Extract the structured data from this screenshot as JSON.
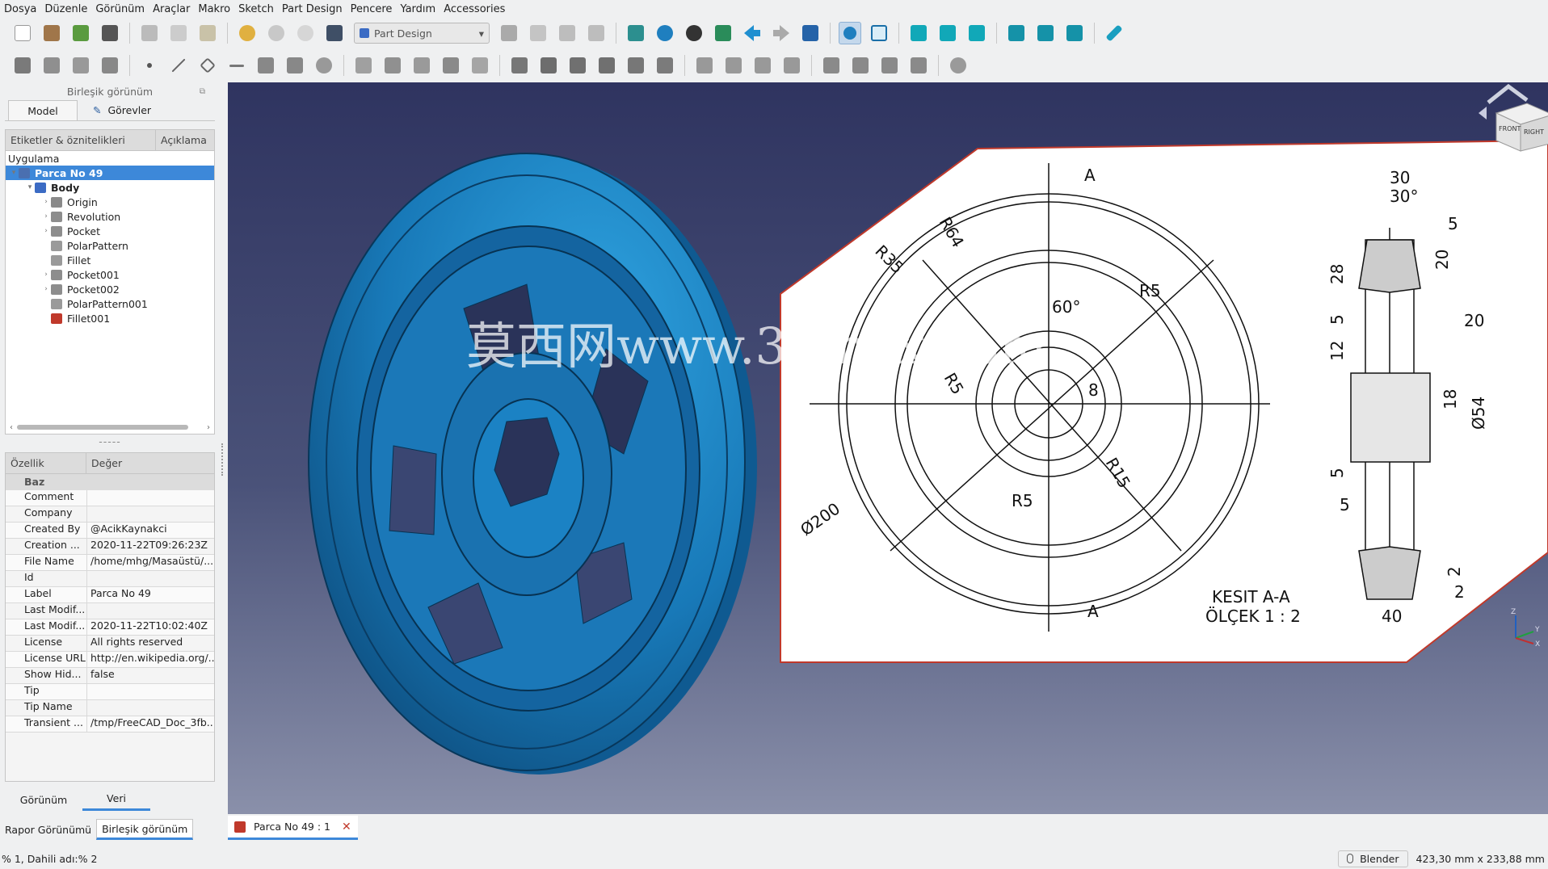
{
  "menubar": {
    "items": [
      "Dosya",
      "Düzenle",
      "Görünüm",
      "Araçlar",
      "Makro",
      "Sketch",
      "Part Design",
      "Pencere",
      "Yardım",
      "Accessories"
    ]
  },
  "toolbar": {
    "workbench": "Part Design"
  },
  "combo_view": {
    "title": "Birleşik görünüm",
    "tabs": [
      "Model",
      "Görevler"
    ],
    "tree_headers": [
      "Etiketler & öznitelikleri",
      "Açıklama"
    ],
    "app_label": "Uygulama",
    "tree": [
      {
        "label": "Parca No 49",
        "depth": 0,
        "expander": "▾",
        "color": "#4a6fb0",
        "selected": true
      },
      {
        "label": "Body",
        "depth": 1,
        "expander": "▾",
        "color": "#3b6bc4",
        "bold": true
      },
      {
        "label": "Origin",
        "depth": 2,
        "expander": "›",
        "color": "#8a8a8a"
      },
      {
        "label": "Revolution",
        "depth": 2,
        "expander": "›",
        "color": "#8d8d8d"
      },
      {
        "label": "Pocket",
        "depth": 2,
        "expander": "›",
        "color": "#8d8d8d"
      },
      {
        "label": "PolarPattern",
        "depth": 2,
        "expander": "",
        "color": "#9a9a9a"
      },
      {
        "label": "Fillet",
        "depth": 2,
        "expander": "",
        "color": "#9a9a9a"
      },
      {
        "label": "Pocket001",
        "depth": 2,
        "expander": "›",
        "color": "#8d8d8d"
      },
      {
        "label": "Pocket002",
        "depth": 2,
        "expander": "›",
        "color": "#8d8d8d"
      },
      {
        "label": "PolarPattern001",
        "depth": 2,
        "expander": "",
        "color": "#9a9a9a"
      },
      {
        "label": "Fillet001",
        "depth": 2,
        "expander": "",
        "color": "#c0392b"
      }
    ],
    "splitter": "-----",
    "prop_headers": [
      "Özellik",
      "Değer"
    ],
    "prop_group": "Baz",
    "properties": [
      {
        "name": "Comment",
        "value": ""
      },
      {
        "name": "Company",
        "value": ""
      },
      {
        "name": "Created By",
        "value": "@AcikKaynakci"
      },
      {
        "name": "Creation ...",
        "value": "2020-11-22T09:26:23Z"
      },
      {
        "name": "File Name",
        "value": "/home/mhg/Masaüstü/..."
      },
      {
        "name": "Id",
        "value": ""
      },
      {
        "name": "Label",
        "value": "Parca No 49"
      },
      {
        "name": "Last Modif...",
        "value": ""
      },
      {
        "name": "Last Modif...",
        "value": "2020-11-22T10:02:40Z"
      },
      {
        "name": "License",
        "value": "All rights reserved"
      },
      {
        "name": "License URL",
        "value": "http://en.wikipedia.org/..."
      },
      {
        "name": "Show Hid...",
        "value": "false"
      },
      {
        "name": "Tip",
        "value": ""
      },
      {
        "name": "Tip Name",
        "value": ""
      },
      {
        "name": "Transient ...",
        "value": "/tmp/FreeCAD_Doc_3fb..."
      }
    ],
    "view_tabs": [
      "Görünüm",
      "Veri"
    ]
  },
  "bottom_tabs": [
    "Rapor Görünümü",
    "Birleşik görünüm"
  ],
  "document_tab": "Parca No 49 : 1",
  "navcube": {
    "front": "FRONT",
    "right": "RIGHT"
  },
  "watermark": "莫西网www.3dmox.com",
  "drawing": {
    "dims": [
      "30",
      "30°",
      "5",
      "20",
      "28",
      "5",
      "20",
      "12",
      "18",
      "Ø54",
      "5",
      "5",
      "2",
      "2",
      "40",
      "R64",
      "R35",
      "R5",
      "60°",
      "R5",
      "8",
      "R15",
      "R5",
      "Ø200",
      "A",
      "A"
    ],
    "title1": "KESIT A-A",
    "title2": "ÖLÇEK 1 : 2"
  },
  "axis": {
    "z": "Z",
    "y": "Y",
    "x": "X"
  },
  "statusbar": {
    "left": "% 1, Dahili adı:% 2",
    "nav": "Blender",
    "dims": "423,30 mm x 233,88 mm"
  },
  "colors": {
    "part": "#1a7fc2",
    "bg_top": "#2f3460",
    "bg_bottom": "#8a90aa",
    "selection": "#3d88d9"
  }
}
